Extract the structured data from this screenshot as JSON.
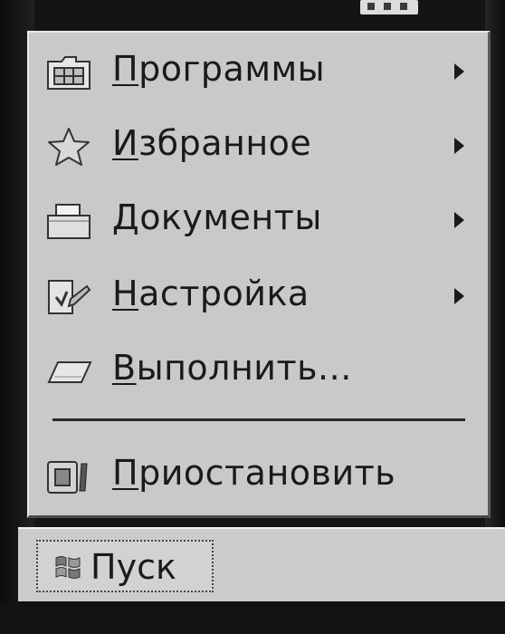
{
  "start_menu": {
    "items": [
      {
        "label_first": "П",
        "label_rest": "рограммы",
        "icon": "programs-folder-icon",
        "has_submenu": true
      },
      {
        "label_first": "И",
        "label_rest": "збранное",
        "icon": "favorites-star-icon",
        "has_submenu": true
      },
      {
        "label_first": "Д",
        "label_rest": "окументы",
        "icon": "documents-folder-icon",
        "has_submenu": true
      },
      {
        "label_first": "Н",
        "label_rest": "астройка",
        "icon": "settings-icon",
        "has_submenu": true
      },
      {
        "label_first": "В",
        "label_rest": "ыполнить...",
        "icon": "run-icon",
        "has_submenu": false
      },
      {
        "label_first": "П",
        "label_rest": "риостановить",
        "icon": "suspend-icon",
        "has_submenu": false
      }
    ]
  },
  "taskbar": {
    "start_label": "Пуск",
    "start_icon": "windows-flag-icon"
  },
  "colors": {
    "menu_bg": "#c9c9c9",
    "text": "#1a1a1a",
    "background": "#151515"
  }
}
